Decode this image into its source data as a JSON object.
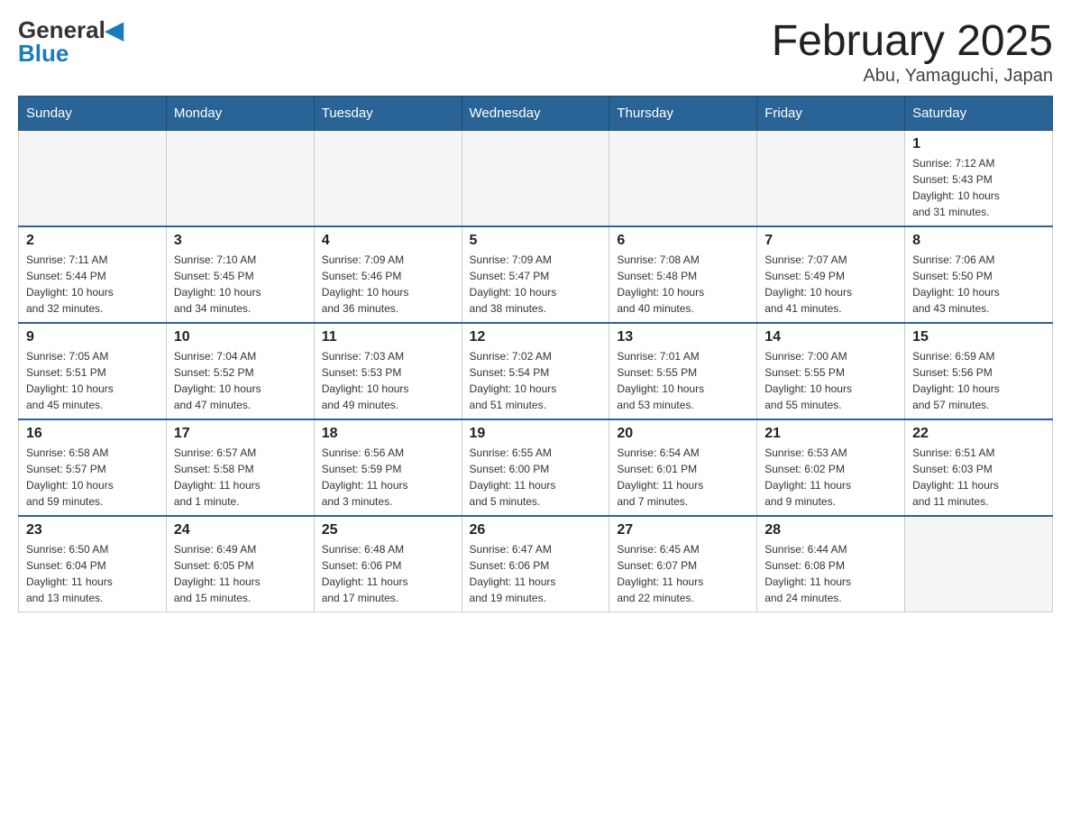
{
  "header": {
    "logo_general": "General",
    "logo_blue": "Blue",
    "title": "February 2025",
    "subtitle": "Abu, Yamaguchi, Japan"
  },
  "days_of_week": [
    "Sunday",
    "Monday",
    "Tuesday",
    "Wednesday",
    "Thursday",
    "Friday",
    "Saturday"
  ],
  "weeks": [
    {
      "days": [
        {
          "number": "",
          "info": ""
        },
        {
          "number": "",
          "info": ""
        },
        {
          "number": "",
          "info": ""
        },
        {
          "number": "",
          "info": ""
        },
        {
          "number": "",
          "info": ""
        },
        {
          "number": "",
          "info": ""
        },
        {
          "number": "1",
          "info": "Sunrise: 7:12 AM\nSunset: 5:43 PM\nDaylight: 10 hours\nand 31 minutes."
        }
      ]
    },
    {
      "days": [
        {
          "number": "2",
          "info": "Sunrise: 7:11 AM\nSunset: 5:44 PM\nDaylight: 10 hours\nand 32 minutes."
        },
        {
          "number": "3",
          "info": "Sunrise: 7:10 AM\nSunset: 5:45 PM\nDaylight: 10 hours\nand 34 minutes."
        },
        {
          "number": "4",
          "info": "Sunrise: 7:09 AM\nSunset: 5:46 PM\nDaylight: 10 hours\nand 36 minutes."
        },
        {
          "number": "5",
          "info": "Sunrise: 7:09 AM\nSunset: 5:47 PM\nDaylight: 10 hours\nand 38 minutes."
        },
        {
          "number": "6",
          "info": "Sunrise: 7:08 AM\nSunset: 5:48 PM\nDaylight: 10 hours\nand 40 minutes."
        },
        {
          "number": "7",
          "info": "Sunrise: 7:07 AM\nSunset: 5:49 PM\nDaylight: 10 hours\nand 41 minutes."
        },
        {
          "number": "8",
          "info": "Sunrise: 7:06 AM\nSunset: 5:50 PM\nDaylight: 10 hours\nand 43 minutes."
        }
      ]
    },
    {
      "days": [
        {
          "number": "9",
          "info": "Sunrise: 7:05 AM\nSunset: 5:51 PM\nDaylight: 10 hours\nand 45 minutes."
        },
        {
          "number": "10",
          "info": "Sunrise: 7:04 AM\nSunset: 5:52 PM\nDaylight: 10 hours\nand 47 minutes."
        },
        {
          "number": "11",
          "info": "Sunrise: 7:03 AM\nSunset: 5:53 PM\nDaylight: 10 hours\nand 49 minutes."
        },
        {
          "number": "12",
          "info": "Sunrise: 7:02 AM\nSunset: 5:54 PM\nDaylight: 10 hours\nand 51 minutes."
        },
        {
          "number": "13",
          "info": "Sunrise: 7:01 AM\nSunset: 5:55 PM\nDaylight: 10 hours\nand 53 minutes."
        },
        {
          "number": "14",
          "info": "Sunrise: 7:00 AM\nSunset: 5:55 PM\nDaylight: 10 hours\nand 55 minutes."
        },
        {
          "number": "15",
          "info": "Sunrise: 6:59 AM\nSunset: 5:56 PM\nDaylight: 10 hours\nand 57 minutes."
        }
      ]
    },
    {
      "days": [
        {
          "number": "16",
          "info": "Sunrise: 6:58 AM\nSunset: 5:57 PM\nDaylight: 10 hours\nand 59 minutes."
        },
        {
          "number": "17",
          "info": "Sunrise: 6:57 AM\nSunset: 5:58 PM\nDaylight: 11 hours\nand 1 minute."
        },
        {
          "number": "18",
          "info": "Sunrise: 6:56 AM\nSunset: 5:59 PM\nDaylight: 11 hours\nand 3 minutes."
        },
        {
          "number": "19",
          "info": "Sunrise: 6:55 AM\nSunset: 6:00 PM\nDaylight: 11 hours\nand 5 minutes."
        },
        {
          "number": "20",
          "info": "Sunrise: 6:54 AM\nSunset: 6:01 PM\nDaylight: 11 hours\nand 7 minutes."
        },
        {
          "number": "21",
          "info": "Sunrise: 6:53 AM\nSunset: 6:02 PM\nDaylight: 11 hours\nand 9 minutes."
        },
        {
          "number": "22",
          "info": "Sunrise: 6:51 AM\nSunset: 6:03 PM\nDaylight: 11 hours\nand 11 minutes."
        }
      ]
    },
    {
      "days": [
        {
          "number": "23",
          "info": "Sunrise: 6:50 AM\nSunset: 6:04 PM\nDaylight: 11 hours\nand 13 minutes."
        },
        {
          "number": "24",
          "info": "Sunrise: 6:49 AM\nSunset: 6:05 PM\nDaylight: 11 hours\nand 15 minutes."
        },
        {
          "number": "25",
          "info": "Sunrise: 6:48 AM\nSunset: 6:06 PM\nDaylight: 11 hours\nand 17 minutes."
        },
        {
          "number": "26",
          "info": "Sunrise: 6:47 AM\nSunset: 6:06 PM\nDaylight: 11 hours\nand 19 minutes."
        },
        {
          "number": "27",
          "info": "Sunrise: 6:45 AM\nSunset: 6:07 PM\nDaylight: 11 hours\nand 22 minutes."
        },
        {
          "number": "28",
          "info": "Sunrise: 6:44 AM\nSunset: 6:08 PM\nDaylight: 11 hours\nand 24 minutes."
        },
        {
          "number": "",
          "info": ""
        }
      ]
    }
  ]
}
